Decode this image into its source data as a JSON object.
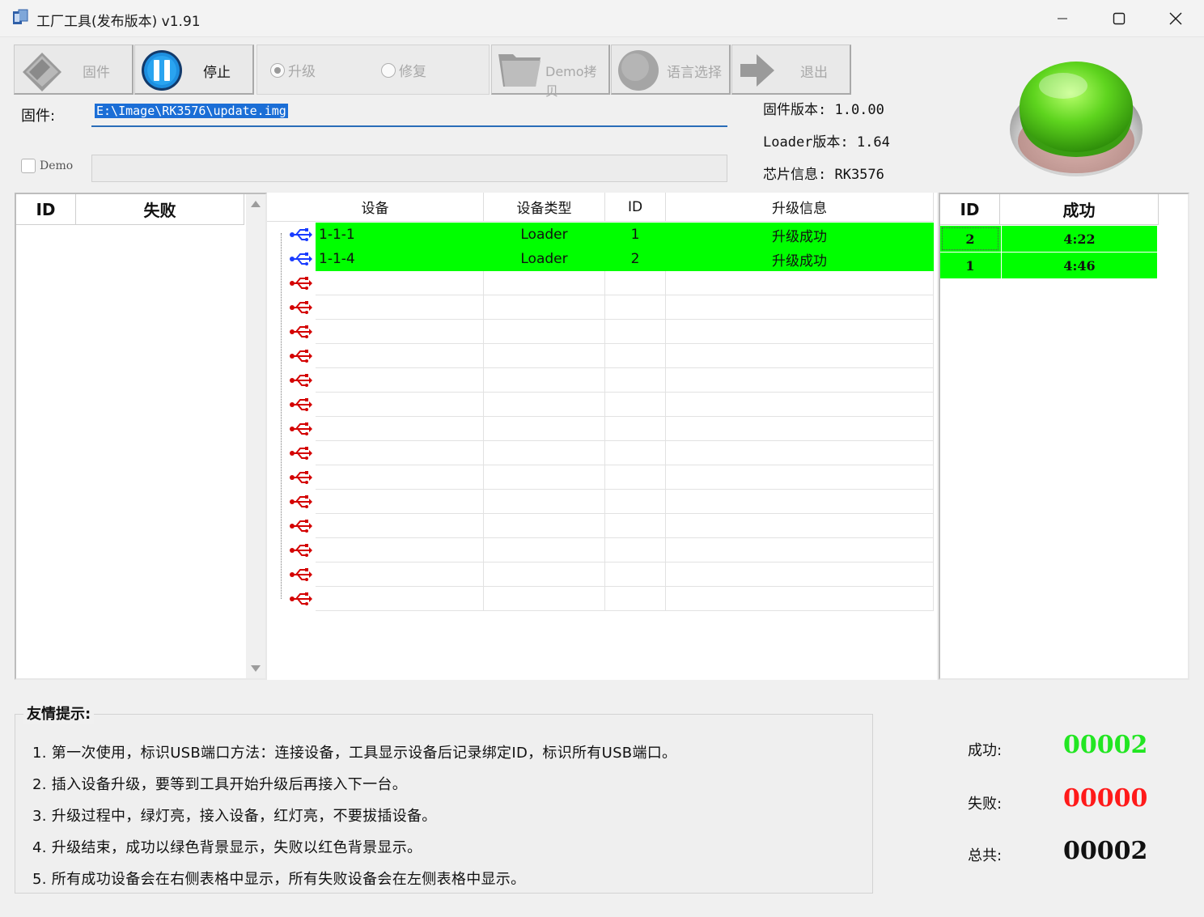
{
  "window": {
    "title": "工厂工具(发布版本) v1.91",
    "minimize": "—",
    "maximize": "☐",
    "close": "✕"
  },
  "toolbar": {
    "firmware_label": "固件",
    "stop_label": "停止",
    "upgrade_label": "升级",
    "repair_label": "修复",
    "mode_selected": "升级",
    "demo_copy_label": "Demo拷贝",
    "language_label": "语言选择",
    "exit_label": "退出"
  },
  "firmware": {
    "label": "固件:",
    "path": "E:\\Image\\RK3576\\update.img",
    "demo_label": "Demo",
    "demo_checked": false,
    "demo_path": ""
  },
  "info": {
    "fw_version": "固件版本: 1.0.00",
    "loader_version": "Loader版本: 1.64",
    "chip_info": "芯片信息: RK3576"
  },
  "status_light": {
    "color": "#3fbf1a",
    "state": "green"
  },
  "fail_table": {
    "columns": [
      "ID",
      "失败"
    ],
    "rows": []
  },
  "device_table": {
    "columns": [
      "设备",
      "设备类型",
      "ID",
      "升级信息"
    ],
    "rows": [
      {
        "device": "1-1-1",
        "type": "Loader",
        "id": "1",
        "info": "升级成功",
        "connected": true
      },
      {
        "device": "1-1-4",
        "type": "Loader",
        "id": "2",
        "info": "升级成功",
        "connected": true
      },
      {
        "device": "",
        "type": "",
        "id": "",
        "info": "",
        "connected": false
      },
      {
        "device": "",
        "type": "",
        "id": "",
        "info": "",
        "connected": false
      },
      {
        "device": "",
        "type": "",
        "id": "",
        "info": "",
        "connected": false
      },
      {
        "device": "",
        "type": "",
        "id": "",
        "info": "",
        "connected": false
      },
      {
        "device": "",
        "type": "",
        "id": "",
        "info": "",
        "connected": false
      },
      {
        "device": "",
        "type": "",
        "id": "",
        "info": "",
        "connected": false
      },
      {
        "device": "",
        "type": "",
        "id": "",
        "info": "",
        "connected": false
      },
      {
        "device": "",
        "type": "",
        "id": "",
        "info": "",
        "connected": false
      },
      {
        "device": "",
        "type": "",
        "id": "",
        "info": "",
        "connected": false
      },
      {
        "device": "",
        "type": "",
        "id": "",
        "info": "",
        "connected": false
      },
      {
        "device": "",
        "type": "",
        "id": "",
        "info": "",
        "connected": false
      },
      {
        "device": "",
        "type": "",
        "id": "",
        "info": "",
        "connected": false
      },
      {
        "device": "",
        "type": "",
        "id": "",
        "info": "",
        "connected": false
      },
      {
        "device": "",
        "type": "",
        "id": "",
        "info": "",
        "connected": false
      }
    ]
  },
  "success_table": {
    "columns": [
      "ID",
      "成功"
    ],
    "rows": [
      {
        "id": "2",
        "time": "4:22"
      },
      {
        "id": "1",
        "time": "4:46"
      }
    ]
  },
  "tips": {
    "title": "友情提示:",
    "lines": [
      "1. 第一次使用，标识USB端口方法：连接设备，工具显示设备后记录绑定ID，标识所有USB端口。",
      "2. 插入设备升级，要等到工具开始升级后再接入下一台。",
      "3. 升级过程中，绿灯亮，接入设备，红灯亮，不要拔插设备。",
      "4. 升级结束，成功以绿色背景显示，失败以红色背景显示。",
      "5. 所有成功设备会在右侧表格中显示，所有失败设备会在左侧表格中显示。"
    ]
  },
  "stats": {
    "success_label": "成功:",
    "success_value": "00002",
    "success_color": "#22e622",
    "fail_label": "失败:",
    "fail_value": "00000",
    "fail_color": "#ff1a1a",
    "total_label": "总共:",
    "total_value": "00002",
    "total_color": "#111111"
  },
  "colors": {
    "row_success": "#00ff00",
    "usb_connected": "#1a3cff",
    "usb_disconnected": "#d40000",
    "input_selection": "#1b6ed6"
  }
}
